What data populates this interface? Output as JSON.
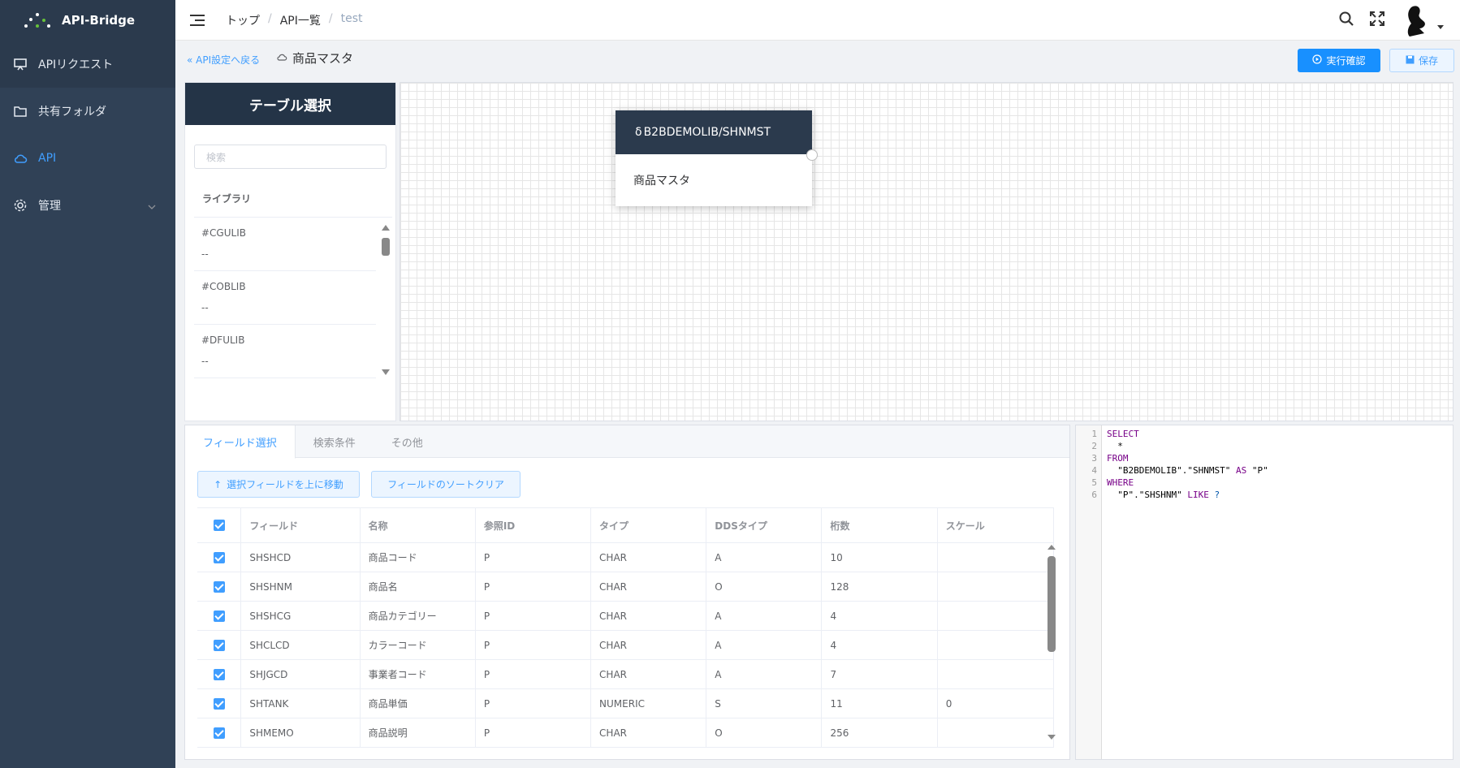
{
  "app": {
    "title": "API-Bridge"
  },
  "sidebar": {
    "items": [
      {
        "label": "APIリクエスト",
        "icon": "monitor-icon"
      },
      {
        "label": "共有フォルダ",
        "icon": "folder-icon"
      },
      {
        "label": "API",
        "icon": "cloud-icon"
      },
      {
        "label": "管理",
        "icon": "gear-icon"
      }
    ]
  },
  "header": {
    "breadcrumb": [
      "トップ",
      "API一覧",
      "test"
    ],
    "sep": "/"
  },
  "toolbar": {
    "back_label": "API設定へ戻る",
    "api_name": "商品マスタ",
    "run_label": "実行確認",
    "save_label": "保存"
  },
  "table_select": {
    "title": "テーブル選択",
    "search_placeholder": "検索",
    "library_label": "ライブラリ",
    "libraries": [
      {
        "name": "#CGULIB",
        "desc": "--"
      },
      {
        "name": "#COBLIB",
        "desc": "--"
      },
      {
        "name": "#DFULIB",
        "desc": "--"
      }
    ]
  },
  "node": {
    "title": "B2BDEMOLIB/SHNMST",
    "label": "商品マスタ"
  },
  "fields": {
    "tabs": [
      "フィールド選択",
      "検索条件",
      "その他"
    ],
    "move_up_label": "選択フィールドを上に移動",
    "sort_clear_label": "フィールドのソートクリア",
    "columns": [
      "フィールド",
      "名称",
      "参照ID",
      "タイプ",
      "DDSタイプ",
      "桁数",
      "スケール"
    ],
    "rows": [
      [
        "SHSHCD",
        "商品コード",
        "P",
        "CHAR",
        "A",
        "10",
        ""
      ],
      [
        "SHSHNM",
        "商品名",
        "P",
        "CHAR",
        "O",
        "128",
        ""
      ],
      [
        "SHSHCG",
        "商品カテゴリー",
        "P",
        "CHAR",
        "A",
        "4",
        ""
      ],
      [
        "SHCLCD",
        "カラーコード",
        "P",
        "CHAR",
        "A",
        "4",
        ""
      ],
      [
        "SHJGCD",
        "事業者コード",
        "P",
        "CHAR",
        "A",
        "7",
        ""
      ],
      [
        "SHTANK",
        "商品単価",
        "P",
        "NUMERIC",
        "S",
        "11",
        "0"
      ],
      [
        "SHMEMO",
        "商品説明",
        "P",
        "CHAR",
        "O",
        "256",
        ""
      ]
    ]
  },
  "sql": {
    "lines": [
      {
        "n": "1",
        "kw": "SELECT",
        "rest": ""
      },
      {
        "n": "2",
        "kw": "",
        "rest": "  *"
      },
      {
        "n": "3",
        "kw": "FROM",
        "rest": ""
      },
      {
        "n": "4",
        "kw": "",
        "rest": "  \"B2BDEMOLIB\".\"SHNMST\" ",
        "kw2": "AS",
        "rest2": " \"P\""
      },
      {
        "n": "5",
        "kw": "WHERE",
        "rest": ""
      },
      {
        "n": "6",
        "kw": "",
        "rest": "  \"P\".\"SHSHNM\" ",
        "kw2": "LIKE",
        "rest2": " ",
        "q": "?"
      }
    ]
  },
  "colors": {
    "sidebar": "#304156",
    "accent": "#409eff",
    "primary_btn": "#1890ff",
    "node_head": "#2b3a4d"
  }
}
